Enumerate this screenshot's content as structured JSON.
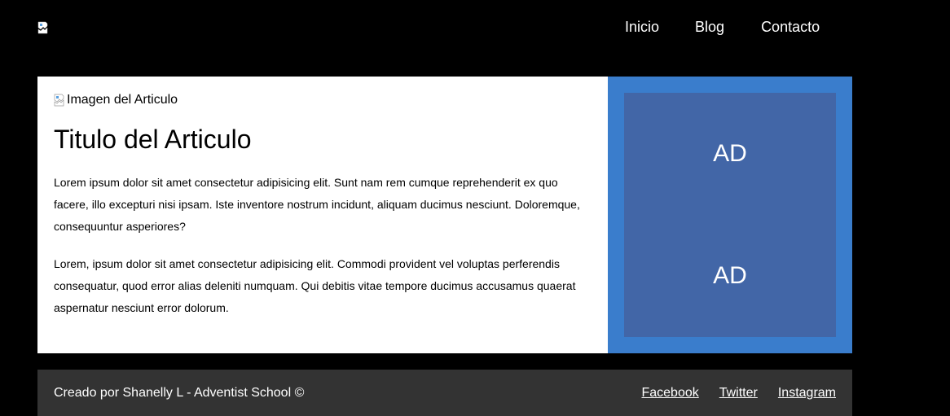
{
  "header": {
    "logo_icon": "broken-image-icon",
    "nav": [
      {
        "label": "Inicio"
      },
      {
        "label": "Blog"
      },
      {
        "label": "Contacto"
      }
    ]
  },
  "article": {
    "image_alt": "Imagen del Articulo",
    "title": "Titulo del Articulo",
    "paragraphs": [
      "Lorem ipsum dolor sit amet consectetur adipisicing elit. Sunt nam rem cumque reprehenderit ex quo facere, illo excepturi nisi ipsam. Iste inventore nostrum incidunt, aliquam ducimus nesciunt. Doloremque, consequuntur asperiores?",
      "Lorem, ipsum dolor sit amet consectetur adipisicing elit. Commodi provident vel voluptas perferendis consequatur, quod error alias deleniti numquam. Qui debitis vitae tempore ducimus accusamus quaerat aspernatur nesciunt error dolorum."
    ]
  },
  "sidebar": {
    "ads": [
      "AD",
      "AD"
    ]
  },
  "footer": {
    "credit": "Creado por Shanelly L - Adventist School ©",
    "links": [
      {
        "label": "Facebook"
      },
      {
        "label": "Twitter"
      },
      {
        "label": "Instagram"
      }
    ]
  },
  "colors": {
    "background": "#000000",
    "sidebar": "#3a7dcc",
    "ad_box": "#4266a7",
    "footer": "#333333"
  }
}
